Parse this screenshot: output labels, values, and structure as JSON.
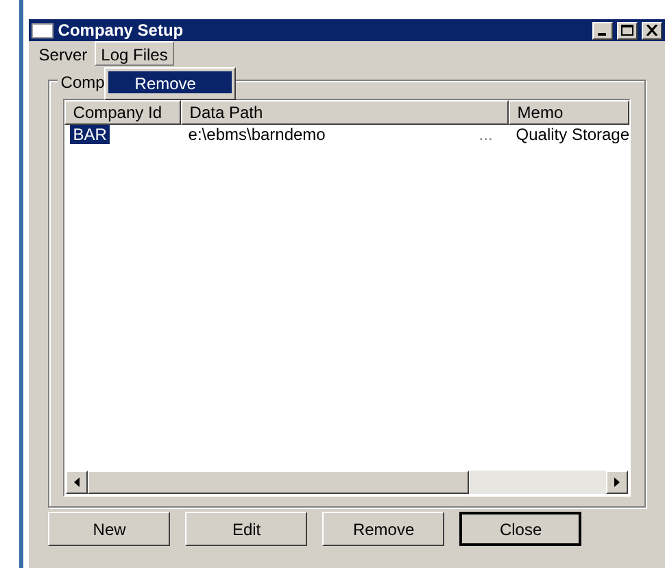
{
  "window": {
    "title": "Company Setup"
  },
  "menu": [
    {
      "label": "Server",
      "selected": false
    },
    {
      "label": "Log Files",
      "selected": true
    }
  ],
  "dropdown": [
    {
      "label": "Remove",
      "selected": true
    }
  ],
  "group": {
    "label": "Comp"
  },
  "table": {
    "columns": [
      "Company Id",
      "Data Path",
      "Memo"
    ],
    "rows": [
      {
        "cells": [
          "BAR",
          "e:\\ebms\\barndemo",
          "Quality Storage"
        ],
        "path_button": "...",
        "selected": true
      }
    ]
  },
  "buttons": [
    {
      "label": "New",
      "default": false
    },
    {
      "label": "Edit",
      "default": false
    },
    {
      "label": "Remove",
      "default": false
    },
    {
      "label": "Close",
      "default": true
    }
  ]
}
